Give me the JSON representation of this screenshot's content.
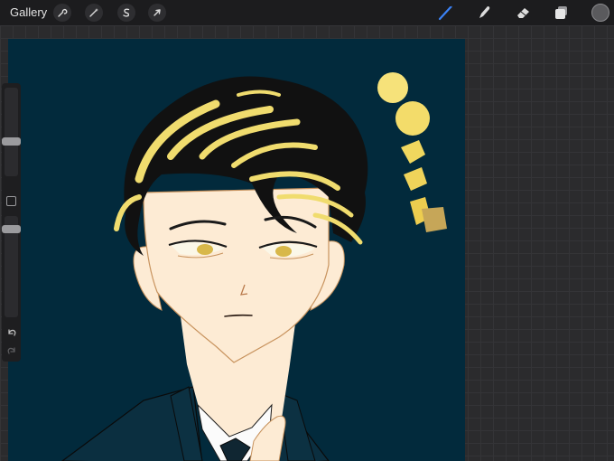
{
  "toolbar": {
    "gallery_label": "Gallery",
    "left_tools": [
      {
        "name": "actions",
        "icon": "wrench-icon"
      },
      {
        "name": "adjustments",
        "icon": "magic-wand-icon"
      },
      {
        "name": "selection",
        "icon": "selection-s-icon"
      },
      {
        "name": "transform",
        "icon": "arrow-cursor-icon"
      }
    ],
    "right_tools": [
      {
        "name": "brush",
        "icon": "brush-icon",
        "active": true
      },
      {
        "name": "smudge",
        "icon": "smudge-icon"
      },
      {
        "name": "eraser",
        "icon": "eraser-icon"
      },
      {
        "name": "layers",
        "icon": "layers-icon"
      }
    ],
    "current_color": "#5a5a5d",
    "accent_color": "#3b82f6"
  },
  "sidebar": {
    "brush_size_slider": "size",
    "modify_button": "square-icon",
    "opacity_slider": "opacity",
    "undo_icon": "undo-icon",
    "redo_icon": "redo-icon"
  },
  "artwork": {
    "background_color": "#022a3c",
    "skin_color": "#fdebd4",
    "hair_color": "#111111",
    "highlight_color": "#f0dc6e",
    "swatches": [
      "#f6e27a",
      "#f3dc6a",
      "#f0d75e",
      "#efd35a",
      "#edcd4f",
      "#c6a658"
    ]
  }
}
